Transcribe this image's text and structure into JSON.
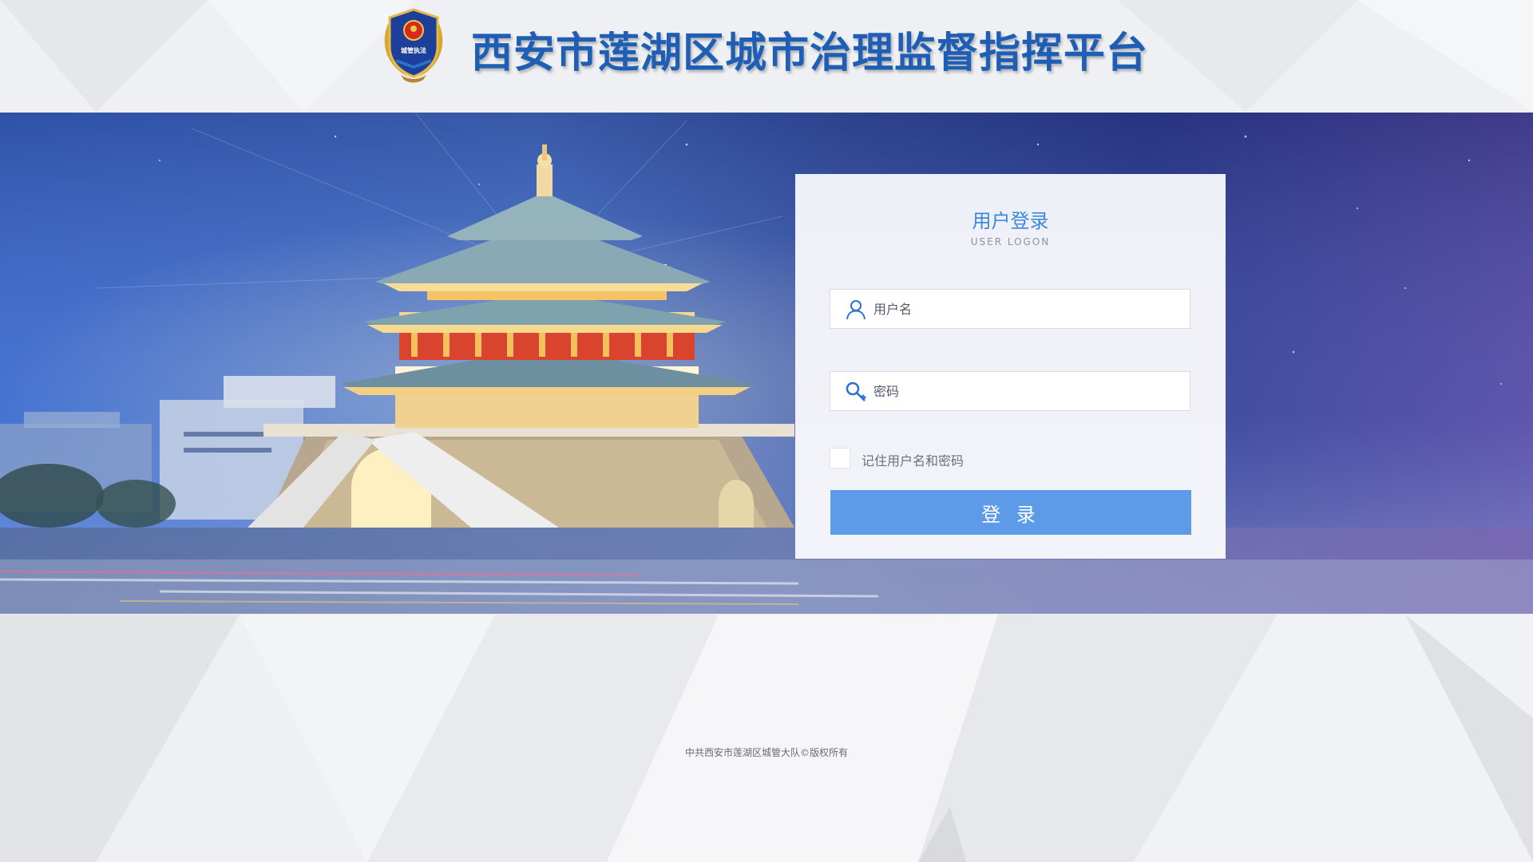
{
  "header": {
    "title": "西安市莲湖区城市治理监督指挥平台",
    "emblem_text": "城管执法"
  },
  "login": {
    "title": "用户登录",
    "subtitle": "USER LOGON",
    "username_placeholder": "用户名",
    "password_placeholder": "密码",
    "remember_label": "记住用户名和密码",
    "remember_checked": false,
    "submit_label": "登 录"
  },
  "footer": {
    "copyright": "中共西安市莲湖区城管大队©版权所有"
  },
  "icons": {
    "emblem": "city-management-emblem-icon",
    "username": "user-icon",
    "password": "key-icon"
  },
  "colors": {
    "title_blue": "#1e5fb5",
    "accent": "#3d88d8",
    "button": "#5d9be9",
    "banner_left": "#3f6fcf",
    "banner_right": "#5d4fa8"
  }
}
